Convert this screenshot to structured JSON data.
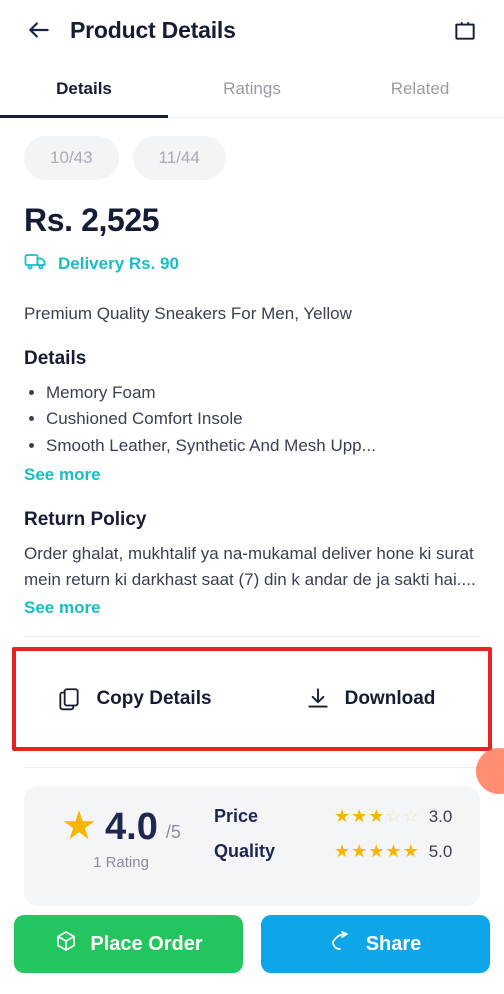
{
  "header": {
    "title": "Product Details",
    "back_icon": "arrow-left-icon",
    "cart_icon": "shopping-bag-icon"
  },
  "tabs": [
    {
      "label": "Details",
      "active": true
    },
    {
      "label": "Ratings",
      "active": false
    },
    {
      "label": "Related",
      "active": false
    }
  ],
  "chips": [
    {
      "label": "10/43"
    },
    {
      "label": "11/44"
    }
  ],
  "product": {
    "price": "Rs. 2,525",
    "delivery": "Delivery Rs. 90",
    "delivery_icon": "truck-icon",
    "description": "Premium Quality Sneakers For Men, Yellow"
  },
  "details": {
    "title": "Details",
    "bullets": [
      "Memory Foam",
      "Cushioned Comfort Insole",
      "Smooth Leather, Synthetic And Mesh Upp..."
    ],
    "see_more": "See more"
  },
  "return_policy": {
    "title": "Return Policy",
    "text": "Order ghalat, mukhtalif ya na-mukamal deliver hone ki surat mein return ki darkhast saat (7) din k andar de ja sakti hai....",
    "see_more": "See more"
  },
  "actions": {
    "copy": {
      "label": "Copy Details",
      "icon": "copy-icon"
    },
    "download": {
      "label": "Download",
      "icon": "download-icon"
    },
    "highlight_color": "#e8231f"
  },
  "ratings": {
    "average": "4.0",
    "denominator": "/5",
    "count": "1 Rating",
    "star_icon": "star-icon",
    "criteria": [
      {
        "label": "Price",
        "value": "3.0",
        "filled": 3
      },
      {
        "label": "Quality",
        "value": "5.0",
        "filled": 5
      }
    ]
  },
  "bottom_bar": {
    "place_order": {
      "label": "Place Order",
      "icon": "box-icon",
      "color": "#22c55e"
    },
    "share": {
      "label": "Share",
      "icon": "share-icon",
      "color": "#0ea5e9"
    }
  }
}
